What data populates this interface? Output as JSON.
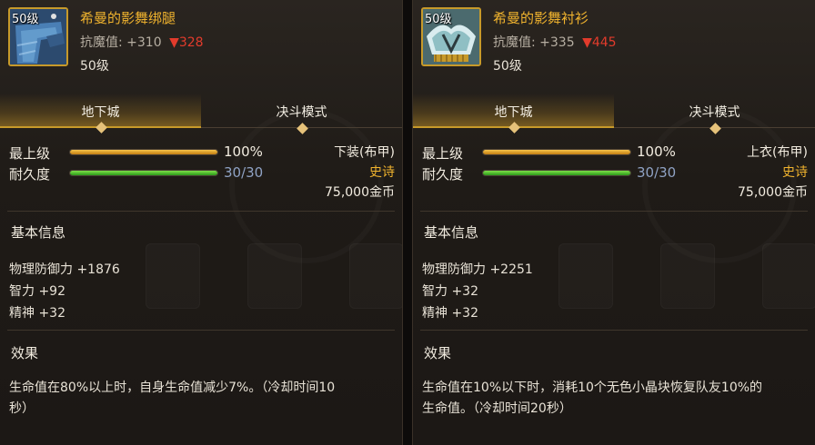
{
  "left": {
    "icon_level": "50级",
    "name": "希曼的影舞绑腿",
    "anti_magic_label": "抗魔值:",
    "anti_magic_value": "+310",
    "anti_magic_change": "▼328",
    "level": "50级",
    "tabs": [
      "地下城",
      "决斗模式"
    ],
    "stats": [
      {
        "label": "最上级",
        "value": "100%",
        "fill": 1.0
      },
      {
        "label": "耐久度",
        "value": "30/30",
        "fill": 1.0
      }
    ],
    "slot": "下装(布甲)",
    "rarity": "史诗",
    "price": "75,000金币",
    "basic_info_title": "基本信息",
    "attributes": [
      "物理防御力 +1876",
      "智力 +92",
      "精神 +32"
    ],
    "effect_title": "效果",
    "effect_lines": [
      "生命值在80%以上时，自身生命值减少7%。（冷却时间10",
      "秒）"
    ]
  },
  "right": {
    "icon_level": "50级",
    "name": "希曼的影舞衬衫",
    "anti_magic_label": "抗魔值:",
    "anti_magic_value": "+335",
    "anti_magic_change": "▼445",
    "level": "50级",
    "tabs": [
      "地下城",
      "决斗模式"
    ],
    "stats": [
      {
        "label": "最上级",
        "value": "100%",
        "fill": 1.0
      },
      {
        "label": "耐久度",
        "value": "30/30",
        "fill": 1.0
      }
    ],
    "slot": "上衣(布甲)",
    "rarity": "史诗",
    "price": "75,000金币",
    "basic_info_title": "基本信息",
    "attributes": [
      "物理防御力 +2251",
      "智力 +32",
      "精神 +32"
    ],
    "effect_title": "效果",
    "effect_lines": [
      "生命值在10%以下时，消耗10个无色小晶块恢复队友10%的",
      "生命值。（冷却时间20秒）"
    ]
  },
  "colors": {
    "gold": "#f0b32e",
    "red": "#e23b2c",
    "blue": "#8fa2c4",
    "green": "#5cc232"
  }
}
